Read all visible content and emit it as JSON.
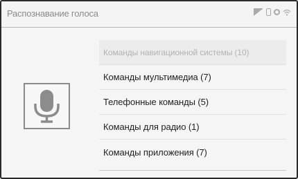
{
  "header": {
    "title": "Распознавание голоса",
    "status_icons": [
      "signal-icon",
      "phone-icon",
      "gear-icon",
      "wifi-icon"
    ]
  },
  "main": {
    "mic_icon": "microphone-icon",
    "commands": [
      {
        "label": "Команды навигационной системы (10)",
        "enabled": false
      },
      {
        "label": "Команды мультимедиа (7)",
        "enabled": true
      },
      {
        "label": "Телефонные команды (5)",
        "enabled": true
      },
      {
        "label": "Команды для радио (1)",
        "enabled": true
      },
      {
        "label": "Команды приложения (7)",
        "enabled": true
      }
    ]
  }
}
